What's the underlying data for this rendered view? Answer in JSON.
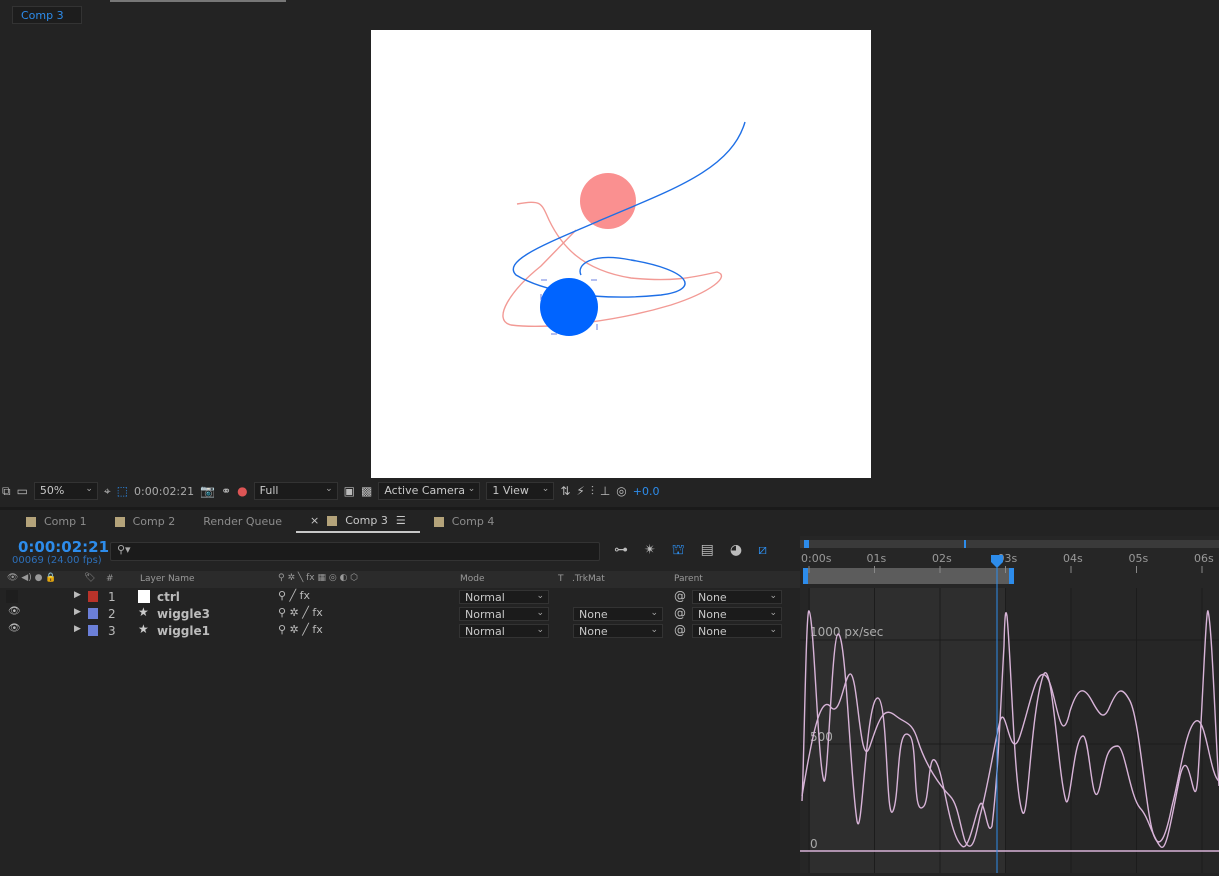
{
  "top_tab": "Comp 3",
  "viewer_toolbar": {
    "zoom": "50%",
    "timecode": "0:00:02:21",
    "resolution": "Full",
    "camera": "Active Camera",
    "views": "1 View",
    "exposure": "+0.0"
  },
  "tabs": [
    {
      "label": "Comp 1"
    },
    {
      "label": "Comp 2"
    },
    {
      "label": "Render Queue"
    },
    {
      "label": "Comp 3",
      "active": true
    },
    {
      "label": "Comp 4"
    }
  ],
  "timeline": {
    "current_time": "0:00:02:21",
    "frame_info": "00069 (24.00 fps)",
    "search_placeholder": ""
  },
  "columns": {
    "num": "#",
    "layer_name": "Layer Name",
    "mode": "Mode",
    "t": "T",
    "trkmat": ".TrkMat",
    "parent": "Parent"
  },
  "layers": [
    {
      "num": "1",
      "name": "ctrl",
      "color": "#b8332a",
      "mode": "Normal",
      "trkmat": "",
      "parent": "None"
    },
    {
      "num": "2",
      "name": "wiggle3",
      "color": "#6b7fd8",
      "mode": "Normal",
      "trkmat": "None",
      "parent": "None"
    },
    {
      "num": "3",
      "name": "wiggle1",
      "color": "#6b7fd8",
      "mode": "Normal",
      "trkmat": "None",
      "parent": "None"
    }
  ],
  "ruler": {
    "ticks": [
      "0:00s",
      "01s",
      "02s",
      "03s",
      "04s",
      "05s",
      "06s"
    ]
  },
  "graph": {
    "labels": [
      "1000 px/sec",
      "500",
      "0"
    ],
    "curve_color": "#d8b4d8"
  }
}
